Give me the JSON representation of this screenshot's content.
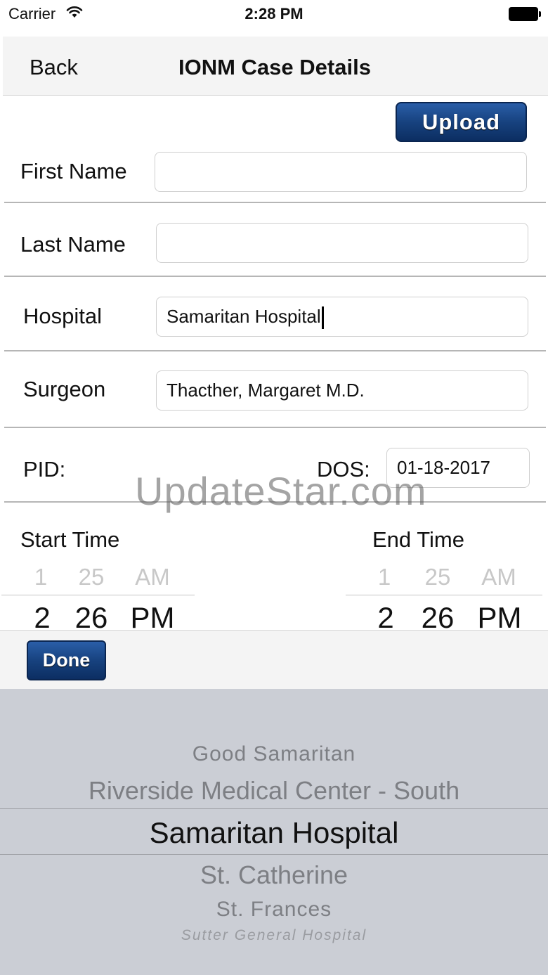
{
  "status_bar": {
    "carrier": "Carrier",
    "time": "2:28 PM"
  },
  "nav": {
    "back_label": "Back",
    "title": "IONM Case Details"
  },
  "upload_label": "Upload",
  "form": {
    "first_name": {
      "label": "First Name",
      "value": ""
    },
    "last_name": {
      "label": "Last Name",
      "value": ""
    },
    "hospital": {
      "label": "Hospital",
      "value": "Samaritan Hospital"
    },
    "surgeon": {
      "label": "Surgeon",
      "value": "Thacther, Margaret M.D."
    },
    "pid": {
      "label": "PID:"
    },
    "dos": {
      "label": "DOS:",
      "value": "01-18-2017"
    }
  },
  "watermark": "UpdateStar.com",
  "start_time": {
    "label": "Start Time",
    "prev": {
      "hour": "1",
      "minute": "25",
      "ampm": "AM"
    },
    "selected": {
      "hour": "2",
      "minute": "26",
      "ampm": "PM"
    }
  },
  "end_time": {
    "label": "End Time",
    "prev": {
      "hour": "1",
      "minute": "25",
      "ampm": "AM"
    },
    "selected": {
      "hour": "2",
      "minute": "26",
      "ampm": "PM"
    }
  },
  "done_label": "Done",
  "hospital_picker": {
    "options": [
      "Good Samaritan",
      "Riverside Medical Center - South",
      "Samaritan Hospital",
      "St. Catherine",
      "St. Frances",
      "Sutter General Hospital"
    ],
    "selected": "Samaritan Hospital"
  }
}
